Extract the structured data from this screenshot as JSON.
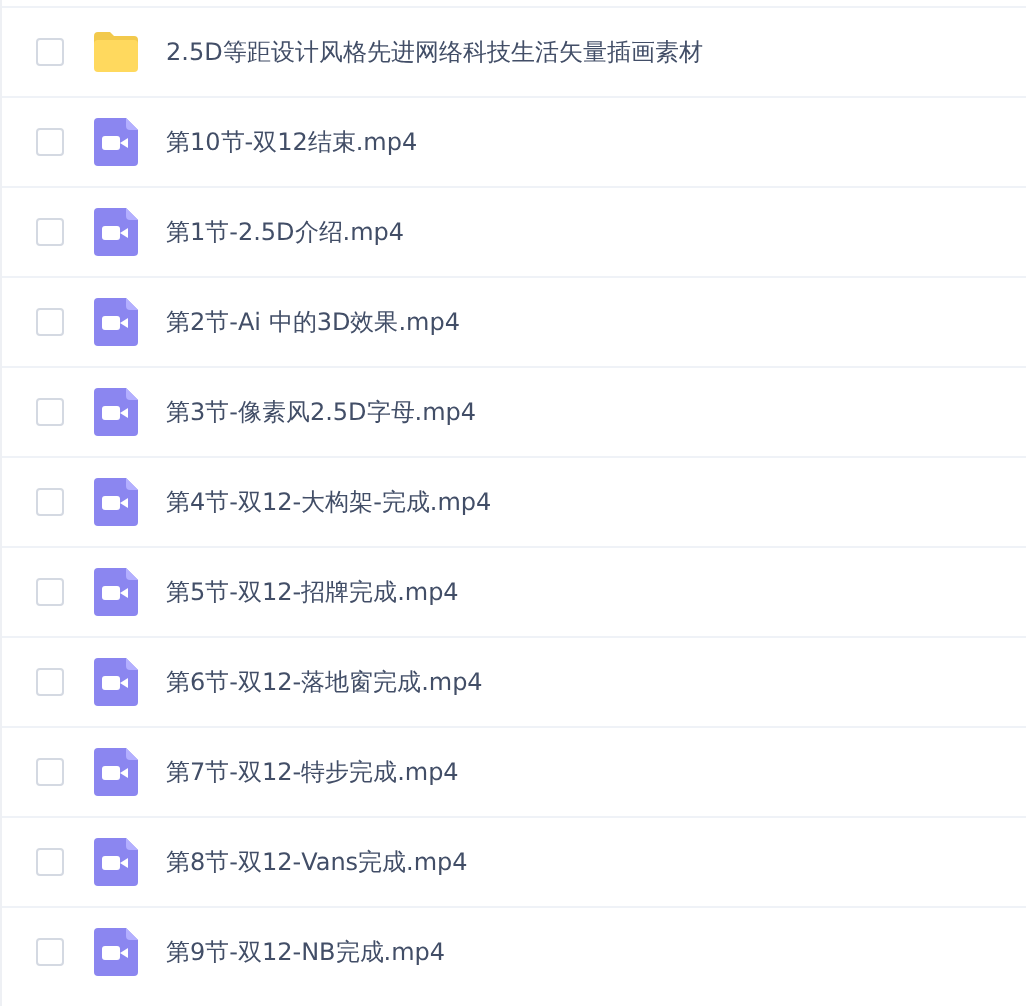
{
  "files": [
    {
      "kind": "folder",
      "name": "2.5D等距设计风格先进网络科技生活矢量插画素材",
      "checked": false
    },
    {
      "kind": "video",
      "name": "第10节-双12结束.mp4",
      "checked": false
    },
    {
      "kind": "video",
      "name": "第1节-2.5D介绍.mp4",
      "checked": false
    },
    {
      "kind": "video",
      "name": "第2节-Ai 中的3D效果.mp4",
      "checked": false
    },
    {
      "kind": "video",
      "name": "第3节-像素风2.5D字母.mp4",
      "checked": false
    },
    {
      "kind": "video",
      "name": "第4节-双12-大构架-完成.mp4",
      "checked": false
    },
    {
      "kind": "video",
      "name": "第5节-双12-招牌完成.mp4",
      "checked": false
    },
    {
      "kind": "video",
      "name": "第6节-双12-落地窗完成.mp4",
      "checked": false
    },
    {
      "kind": "video",
      "name": "第7节-双12-特步完成.mp4",
      "checked": false
    },
    {
      "kind": "video",
      "name": "第8节-双12-Vans完成.mp4",
      "checked": false
    },
    {
      "kind": "video",
      "name": "第9节-双12-NB完成.mp4",
      "checked": false
    }
  ]
}
